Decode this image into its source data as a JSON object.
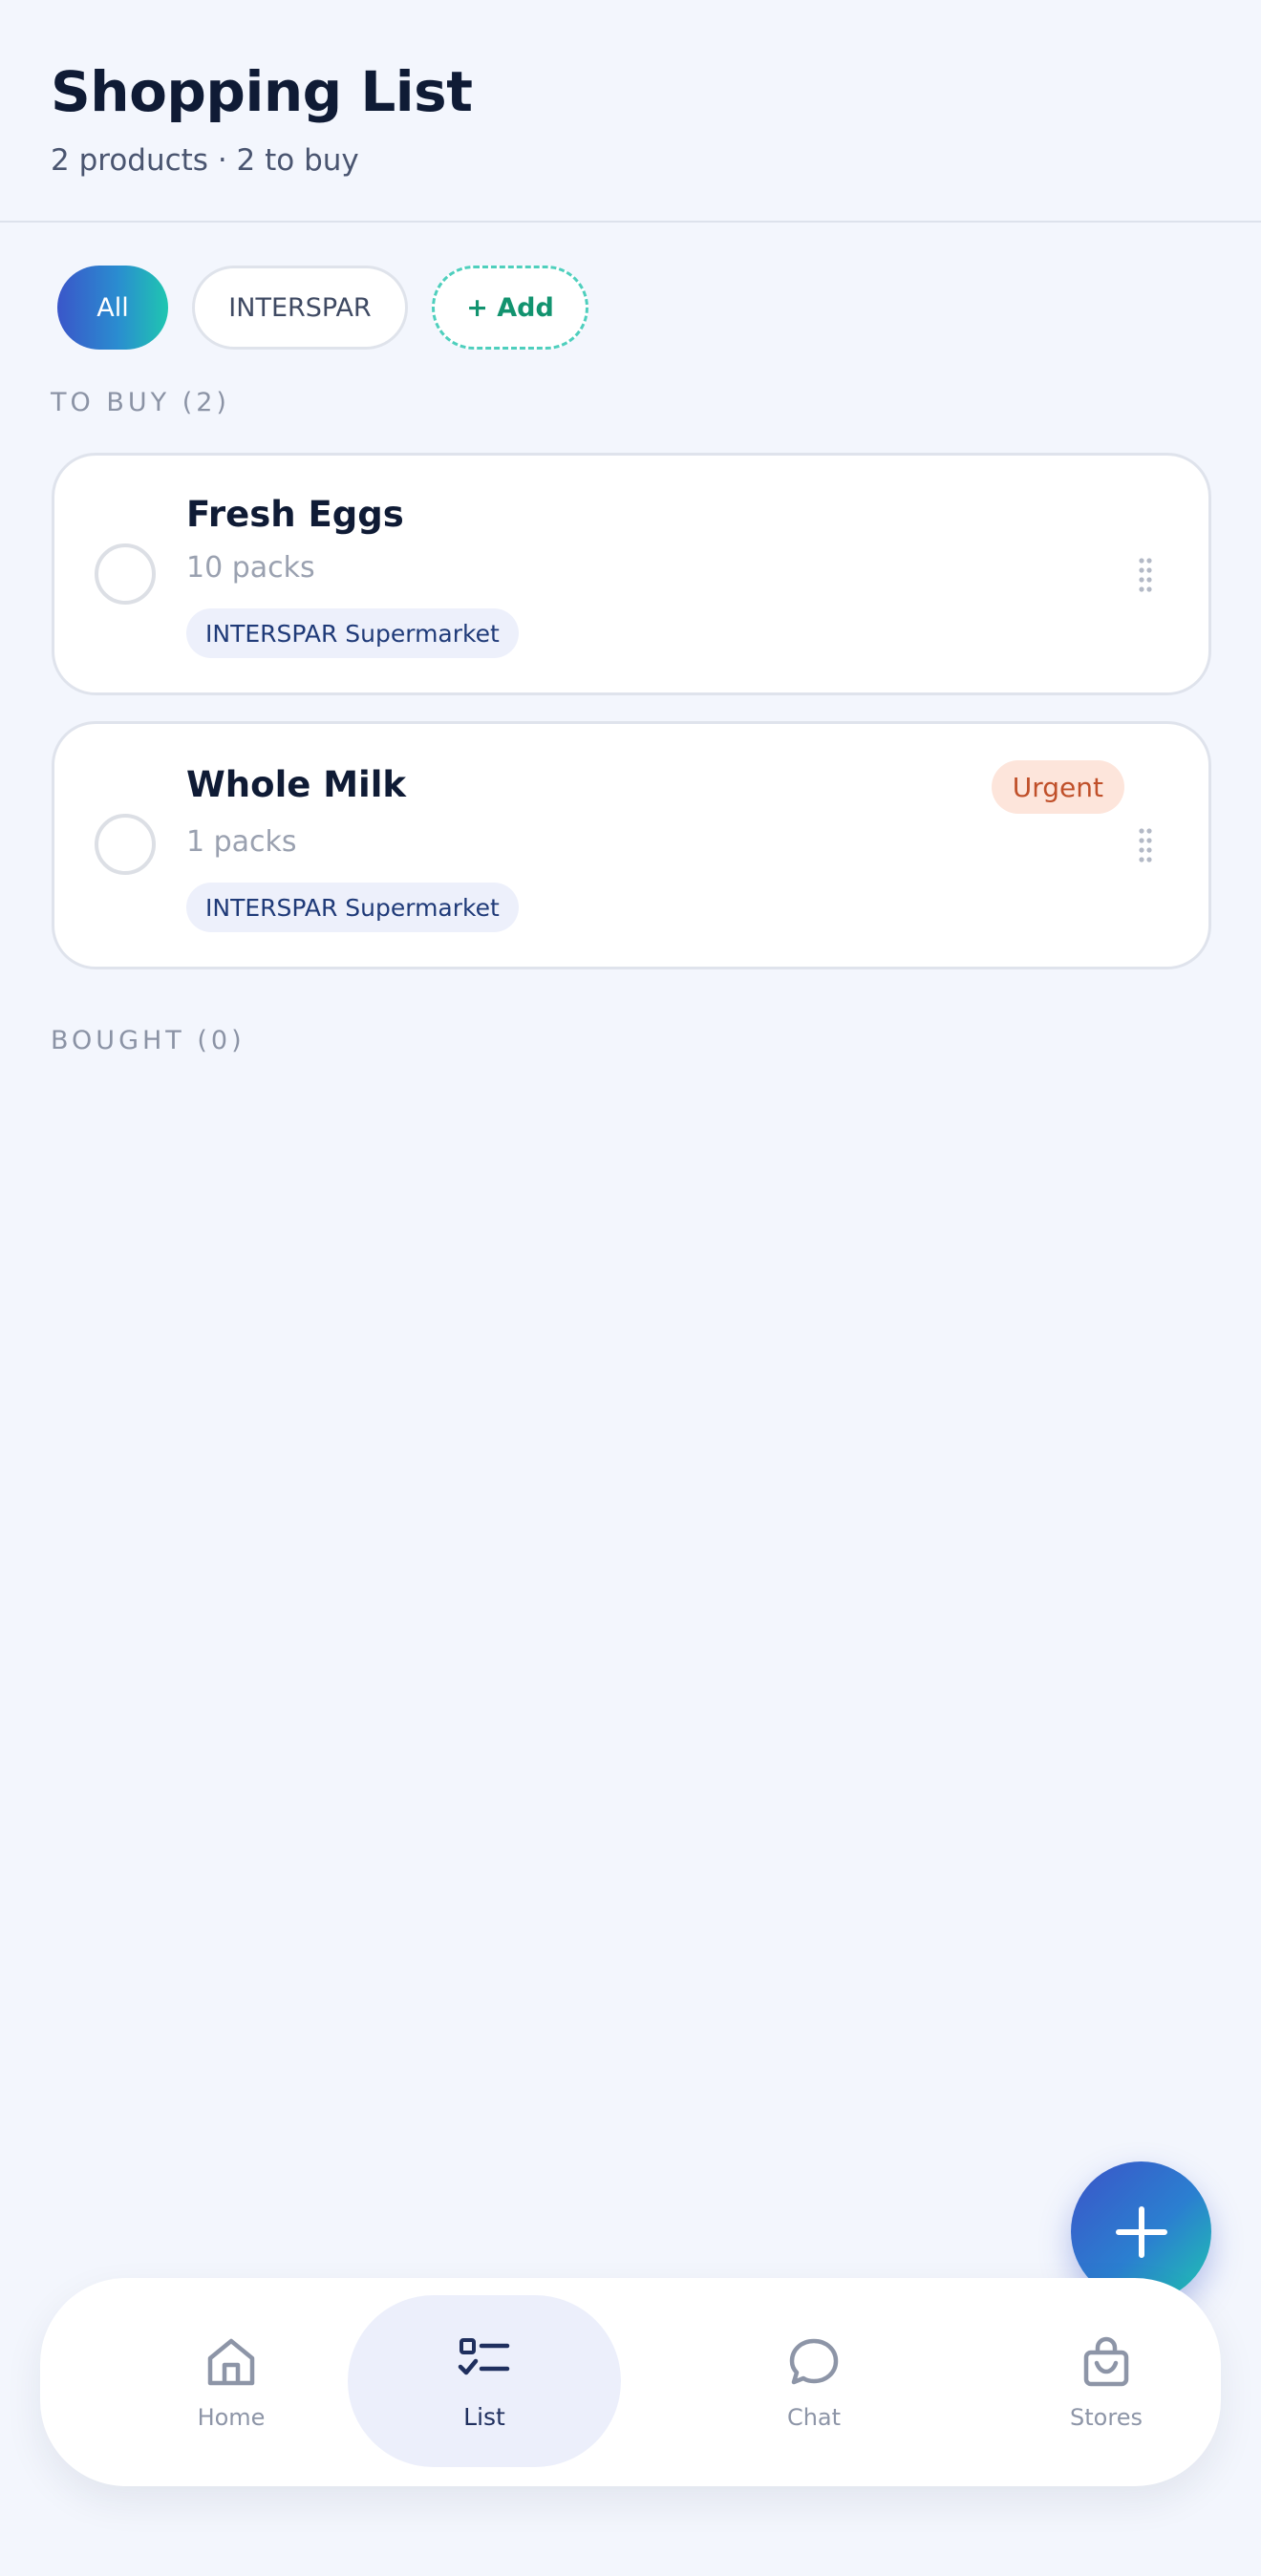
{
  "header": {
    "title": "Shopping List",
    "subtitle": "2 products · 2 to buy"
  },
  "filters": {
    "all_label": "All",
    "store_label": "INTERSPAR",
    "add_label": "+ Add",
    "selected": "All"
  },
  "sections": {
    "to_buy_label": "TO BUY (2)",
    "bought_label": "BOUGHT (0)"
  },
  "items": [
    {
      "name": "Fresh Eggs",
      "quantity": "10 packs",
      "store": "INTERSPAR Supermarket",
      "checked": false
    },
    {
      "name": "Whole Milk",
      "quantity": "1 packs",
      "store": "INTERSPAR Supermarket",
      "badge": "Urgent",
      "checked": false
    }
  ],
  "nav": {
    "home": "Home",
    "list": "List",
    "chat": "Chat",
    "stores": "Stores",
    "active": "List"
  },
  "colors": {
    "background": "#f3f6fd",
    "accent_gradient_start": "#3a56c9",
    "accent_gradient_end": "#1fc6b0",
    "urgent_bg": "#fde5db",
    "urgent_text": "#c0502a",
    "tag_bg": "#edf0fb"
  },
  "icons": {
    "fab": "plus-icon",
    "drag": "drag-handle-icon",
    "home": "home-icon",
    "list": "checklist-icon",
    "chat": "chat-bubble-icon",
    "stores": "shopping-bag-icon"
  }
}
